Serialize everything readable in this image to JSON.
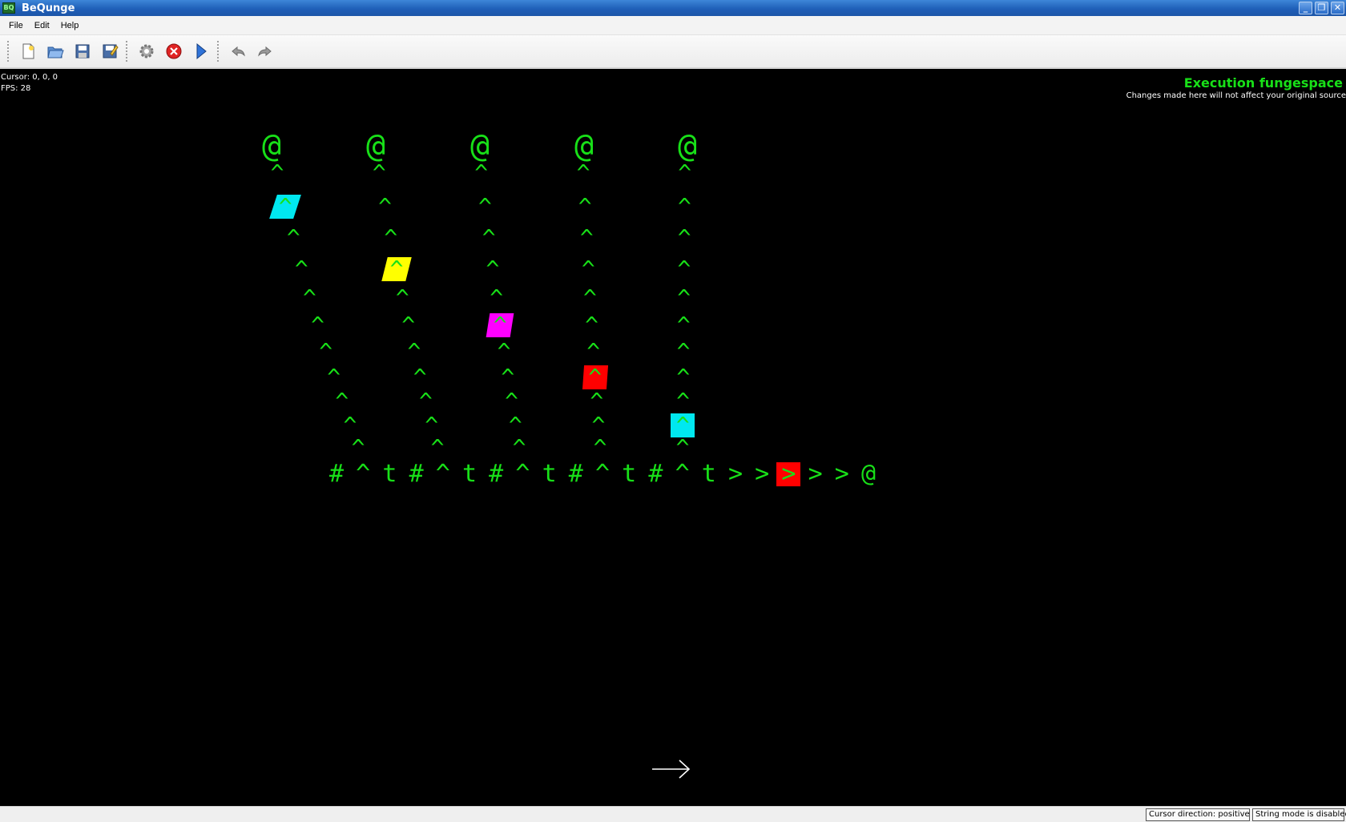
{
  "window": {
    "title": "BeQunge",
    "app_icon": "bequnge-app-icon"
  },
  "menu": [
    "File",
    "Edit",
    "Help"
  ],
  "toolbar": [
    {
      "name": "new-file-button",
      "icon": "new-document-icon"
    },
    {
      "name": "open-file-button",
      "icon": "open-folder-icon"
    },
    {
      "name": "save-button",
      "icon": "floppy-disk-icon"
    },
    {
      "name": "save-as-button",
      "icon": "save-as-icon"
    },
    {
      "name": "debug-button",
      "icon": "gear-icon"
    },
    {
      "name": "stop-button",
      "icon": "stop-icon"
    },
    {
      "name": "run-button",
      "icon": "play-icon"
    },
    {
      "name": "undo-button",
      "icon": "undo-icon"
    },
    {
      "name": "redo-button",
      "icon": "redo-icon"
    }
  ],
  "info": {
    "cursor": "Cursor: 0, 0, 0",
    "fps": "FPS: 28"
  },
  "fungespace": {
    "title": "Execution fungespace",
    "subtitle": "Changes made here will not affect your original source",
    "text_color": "#18e018",
    "bottom_row": [
      "#",
      "^",
      "t",
      "#",
      "^",
      "t",
      "#",
      "^",
      "t",
      "#",
      "^",
      "t",
      "#",
      "^",
      "t",
      ">",
      ">",
      ">",
      ">",
      ">",
      "@"
    ],
    "column_top": "@",
    "column_char": "^",
    "instruction_pointers": [
      {
        "color": "#00e8f0",
        "column": 1,
        "row": 2
      },
      {
        "color": "#ffff00",
        "column": 2,
        "row": 4
      },
      {
        "color": "#ff00ff",
        "column": 3,
        "row": 6
      },
      {
        "color": "#ff0000",
        "column": 4,
        "row": 8
      },
      {
        "color": "#00e8f0",
        "column": 5,
        "row": 10
      },
      {
        "color": "#ff0000",
        "column": "row",
        "row": "bottom"
      }
    ]
  },
  "status": {
    "direction": "Cursor direction: positive x",
    "string_mode": "String mode is disabled"
  }
}
